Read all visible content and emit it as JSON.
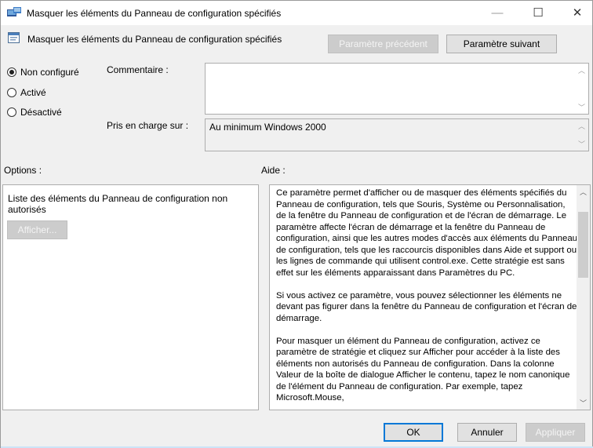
{
  "window": {
    "title": "Masquer les éléments du Panneau de configuration spécifiés",
    "minimize_glyph": "—",
    "maximize_glyph": "☐",
    "close_glyph": "✕",
    "icon": "policy-icon"
  },
  "header": {
    "title": "Masquer les éléments du Panneau de configuration spécifiés",
    "prev_button": "Paramètre précédent",
    "next_button": "Paramètre suivant",
    "icon": "setting-icon"
  },
  "state": {
    "options": [
      {
        "label": "Non configuré",
        "checked": true
      },
      {
        "label": "Activé",
        "checked": false
      },
      {
        "label": "Désactivé",
        "checked": false
      }
    ]
  },
  "comment": {
    "label": "Commentaire :",
    "value": ""
  },
  "supported": {
    "label": "Pris en charge sur :",
    "value": "Au minimum Windows 2000"
  },
  "options_panel": {
    "label": "Options :",
    "item_text": "Liste des éléments du Panneau de configuration non autorisés",
    "show_button": "Afficher..."
  },
  "help_panel": {
    "label": "Aide :",
    "paragraphs": [
      "Ce paramètre permet d'afficher ou de masquer des éléments spécifiés du Panneau de configuration, tels que Souris, Système ou Personnalisation, de la fenêtre du Panneau de configuration et de l'écran de démarrage. Le paramètre affecte l'écran de démarrage et la fenêtre du Panneau de configuration, ainsi que les autres modes d'accès aux éléments du Panneau de configuration, tels que les raccourcis disponibles dans Aide et support ou les lignes de commande qui utilisent control.exe. Cette stratégie est sans effet sur les éléments apparaissant dans Paramètres du PC.",
      "Si vous activez ce paramètre, vous pouvez sélectionner les éléments ne devant pas figurer dans la fenêtre du Panneau de configuration et l'écran de démarrage.",
      "Pour masquer un élément du Panneau de configuration, activez ce paramètre de stratégie et cliquez sur Afficher pour accéder à la liste des éléments non autorisés du Panneau de configuration. Dans la colonne Valeur de la boîte de dialogue Afficher le contenu, tapez le nom canonique de l'élément du Panneau de configuration. Par exemple, tapez Microsoft.Mouse,"
    ]
  },
  "footer": {
    "ok": "OK",
    "cancel": "Annuler",
    "apply": "Appliquer"
  }
}
